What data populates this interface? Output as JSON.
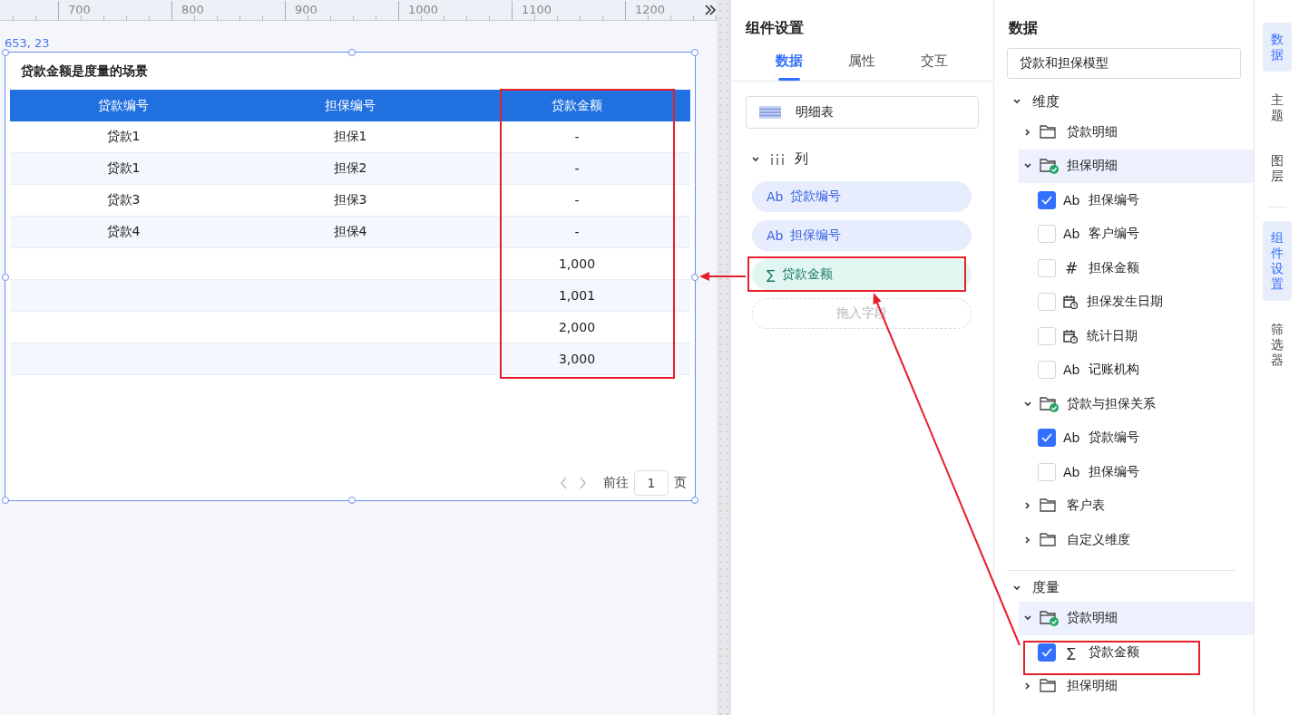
{
  "ruler": {
    "ticks": [
      "700",
      "800",
      "900",
      "1000",
      "1100",
      "1200"
    ]
  },
  "canvas": {
    "position_label": "653, 23",
    "card": {
      "title": "贷款金额是度量的场景",
      "columns": [
        "贷款编号",
        "担保编号",
        "贷款金额"
      ],
      "rows": [
        [
          "贷款1",
          "担保1",
          "-"
        ],
        [
          "贷款1",
          "担保2",
          "-"
        ],
        [
          "贷款3",
          "担保3",
          "-"
        ],
        [
          "贷款4",
          "担保4",
          "-"
        ],
        [
          null,
          null,
          "1,000"
        ],
        [
          null,
          null,
          "1,001"
        ],
        [
          null,
          null,
          "2,000"
        ],
        [
          null,
          null,
          "3,000"
        ]
      ],
      "pagination": {
        "goto_label": "前往",
        "page": "1",
        "suffix": "页"
      }
    }
  },
  "config": {
    "title": "组件设置",
    "tabs": [
      {
        "label": "数据",
        "selected": true
      },
      {
        "label": "属性",
        "selected": false
      },
      {
        "label": "交互",
        "selected": false
      }
    ],
    "chart_type": "明细表",
    "columns_section": {
      "label": "列",
      "expanded": true,
      "fields": [
        {
          "kind": "text",
          "glyph": "Ab",
          "label": "贷款编号"
        },
        {
          "kind": "text",
          "glyph": "Ab",
          "label": "担保编号"
        },
        {
          "kind": "measure",
          "glyph": "∑",
          "label": "贷款金额"
        }
      ],
      "drop_hint": "拖入字段"
    }
  },
  "data": {
    "title": "数据",
    "model": "贷款和担保模型",
    "sections": [
      {
        "label": "维度",
        "expanded": true,
        "children": [
          {
            "label": "贷款明细",
            "expanded": false,
            "used": false,
            "selected": false
          },
          {
            "label": "担保明细",
            "expanded": true,
            "used": true,
            "selected": true,
            "children": [
              {
                "kind": "text",
                "glyph": "Ab",
                "label": "担保编号",
                "checked": true
              },
              {
                "kind": "text",
                "glyph": "Ab",
                "label": "客户编号",
                "checked": false
              },
              {
                "kind": "number",
                "glyph": "#",
                "label": "担保金额",
                "checked": false
              },
              {
                "kind": "date",
                "label": "担保发生日期",
                "checked": false
              },
              {
                "kind": "date",
                "label": "统计日期",
                "checked": false
              },
              {
                "kind": "text",
                "glyph": "Ab",
                "label": "记账机构",
                "checked": false
              }
            ]
          },
          {
            "label": "贷款与担保关系",
            "expanded": true,
            "used": true,
            "selected": false,
            "children": [
              {
                "kind": "text",
                "glyph": "Ab",
                "label": "贷款编号",
                "checked": true
              },
              {
                "kind": "text",
                "glyph": "Ab",
                "label": "担保编号",
                "checked": false
              }
            ]
          },
          {
            "label": "客户表",
            "expanded": false,
            "used": false,
            "selected": false
          },
          {
            "label": "自定义维度",
            "expanded": false,
            "used": false,
            "selected": false
          }
        ]
      },
      {
        "label": "度量",
        "expanded": true,
        "children": [
          {
            "label": "贷款明细",
            "expanded": true,
            "used": true,
            "selected": true,
            "children": [
              {
                "kind": "measure",
                "glyph": "∑",
                "label": "贷款金额",
                "checked": true
              }
            ]
          },
          {
            "label": "担保明细",
            "expanded": false,
            "used": false,
            "selected": false
          }
        ]
      }
    ]
  },
  "side_tabs": [
    {
      "label": "数据",
      "selected": true
    },
    {
      "label": "主题",
      "selected": false
    },
    {
      "label": "图层",
      "selected": false
    },
    {
      "label": "组件设置",
      "selected": true
    },
    {
      "label": "筛选器",
      "selected": false
    }
  ]
}
